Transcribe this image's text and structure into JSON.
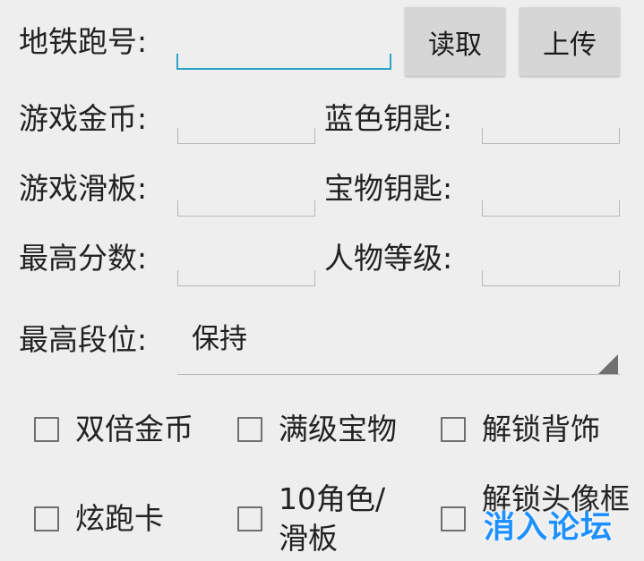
{
  "form": {
    "subway_id_label": "地铁跑号:",
    "subway_id_value": "",
    "read_button": "读取",
    "upload_button": "上传",
    "game_coins_label": "游戏金币:",
    "game_coins_value": "",
    "blue_keys_label": "蓝色钥匙:",
    "blue_keys_value": "",
    "hoverboards_label": "游戏滑板:",
    "hoverboards_value": "",
    "treasure_keys_label": "宝物钥匙:",
    "treasure_keys_value": "",
    "high_score_label": "最高分数:",
    "high_score_value": "",
    "character_level_label": "人物等级:",
    "character_level_value": "",
    "highest_rank_label": "最高段位:",
    "highest_rank_selected": "保持"
  },
  "options": {
    "double_coins": {
      "label": "双倍金币",
      "checked": false
    },
    "max_treasures": {
      "label": "满级宝物",
      "checked": false
    },
    "unlock_backpack": {
      "label": "解锁背饰",
      "checked": false
    },
    "flash_run_card": {
      "label": "炫跑卡",
      "checked": false
    },
    "ten_characters": {
      "label": "10角色/滑板",
      "checked": false
    },
    "unlock_avatar_frame": {
      "label": "解锁头像框",
      "checked": false
    }
  },
  "watermark": {
    "text": "消入论坛"
  },
  "colors": {
    "background": "#eeeeee",
    "active_underline": "#2aa3c7",
    "button_bg": "#d6d6d6",
    "watermark": "#1e90ff"
  }
}
